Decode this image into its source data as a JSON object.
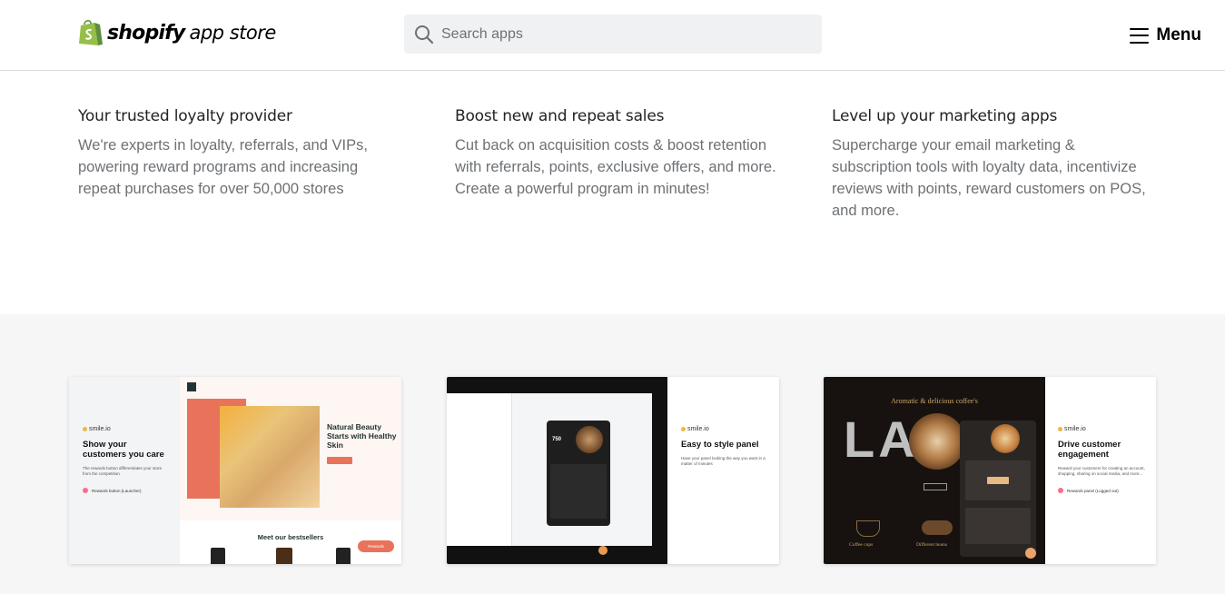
{
  "header": {
    "logo_bold": "shopify",
    "logo_light": "app store",
    "search_placeholder": "Search apps",
    "menu_label": "Menu"
  },
  "features": [
    {
      "title": "Your trusted loyalty provider",
      "body": "We're experts in loyalty, referrals, and VIPs, powering reward programs and increasing repeat purchases for over 50,000 stores"
    },
    {
      "title": "Boost new and repeat sales",
      "body": "Cut back on acquisition costs & boost retention with referrals, points, exclusive offers, and more. Create a powerful program in minutes!"
    },
    {
      "title": "Level up your marketing apps",
      "body": "Supercharge your email marketing & subscription tools with loyalty data, incentivize reviews with points, reward customers on POS, and more."
    }
  ],
  "screenshots": [
    {
      "brand": "smile.io",
      "title": "Show your customers you care",
      "desc": "The rewards button differentiates your store from the competition",
      "badge": "Rewards button (Launcher)",
      "hero_title": "Natural Beauty Starts with Healthy Skin",
      "hero_sub": "Meet our bestsellers",
      "rewards_btn": "Rewards"
    },
    {
      "brand": "smile.io",
      "title": "Easy to style panel",
      "desc": "Have your panel looking the way you want in a matter of minutes",
      "points": "750"
    },
    {
      "brand": "smile.io",
      "title": "Drive customer engagement",
      "desc": "Reward your customers for creating an account, shopping, sharing on social media, and more...",
      "badge": "Rewards panel (Logged out)",
      "hero_title": "Aromatic & delicious coffee's",
      "hero_big": "LA",
      "label_a": "Coffee cups",
      "label_b": "Different beans"
    }
  ],
  "colors": {
    "shopify_green": "#95bf47",
    "shopify_green_dark": "#5e8e3e",
    "text_primary": "#212326",
    "text_secondary": "#6d7175",
    "gallery_bg": "#f6f6f7",
    "search_bg": "#f0f1f2"
  }
}
